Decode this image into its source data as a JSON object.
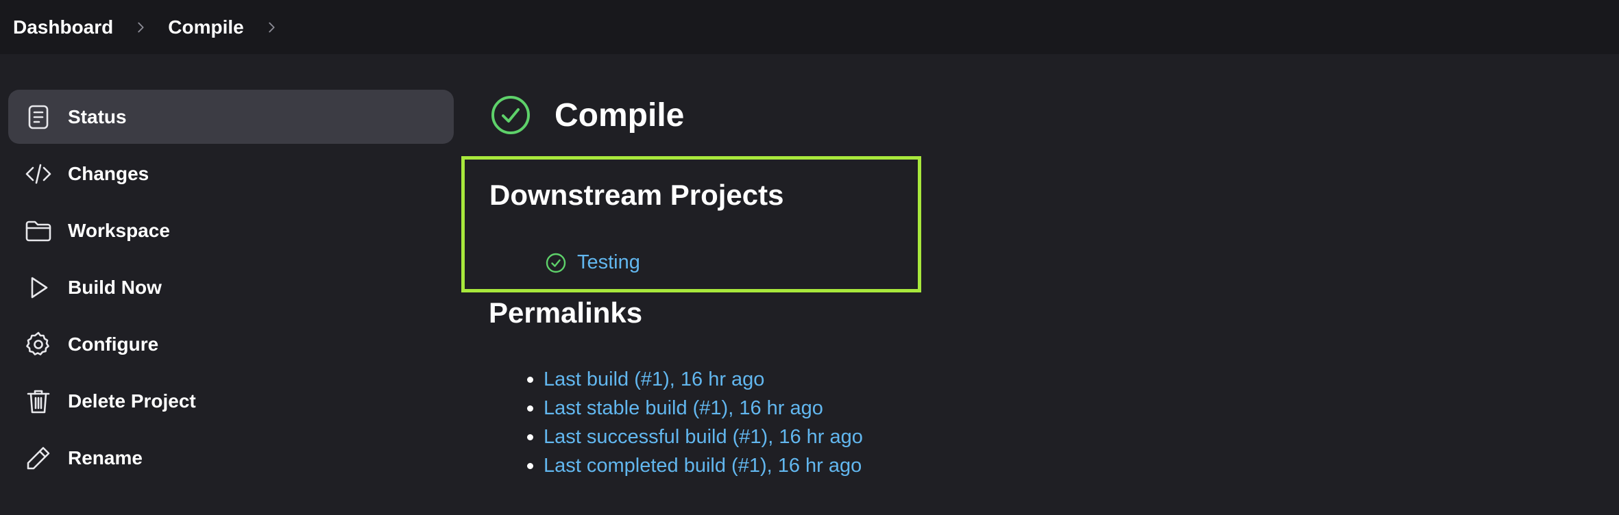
{
  "breadcrumb": {
    "items": [
      "Dashboard",
      "Compile"
    ]
  },
  "sidebar": {
    "items": [
      {
        "label": "Status",
        "icon": "document-icon",
        "active": true
      },
      {
        "label": "Changes",
        "icon": "code-icon"
      },
      {
        "label": "Workspace",
        "icon": "folder-icon"
      },
      {
        "label": "Build Now",
        "icon": "play-icon"
      },
      {
        "label": "Configure",
        "icon": "gear-icon"
      },
      {
        "label": "Delete Project",
        "icon": "trash-icon"
      },
      {
        "label": "Rename",
        "icon": "pencil-icon"
      }
    ]
  },
  "main": {
    "title": "Compile",
    "status_icon": "check-circle-icon",
    "downstream": {
      "heading": "Downstream Projects",
      "items": [
        {
          "label": "Testing",
          "status_icon": "check-circle-icon"
        }
      ]
    },
    "permalinks": {
      "heading": "Permalinks",
      "items": [
        "Last build (#1), 16 hr ago",
        "Last stable build (#1), 16 hr ago",
        "Last successful build (#1), 16 hr ago",
        "Last completed build (#1), 16 hr ago"
      ]
    }
  },
  "colors": {
    "background": "#1f1f24",
    "topbar": "#18181c",
    "active_item": "#3c3c44",
    "success": "#5ed16a",
    "link": "#62b7ef",
    "highlight_border": "#a8e83c"
  }
}
